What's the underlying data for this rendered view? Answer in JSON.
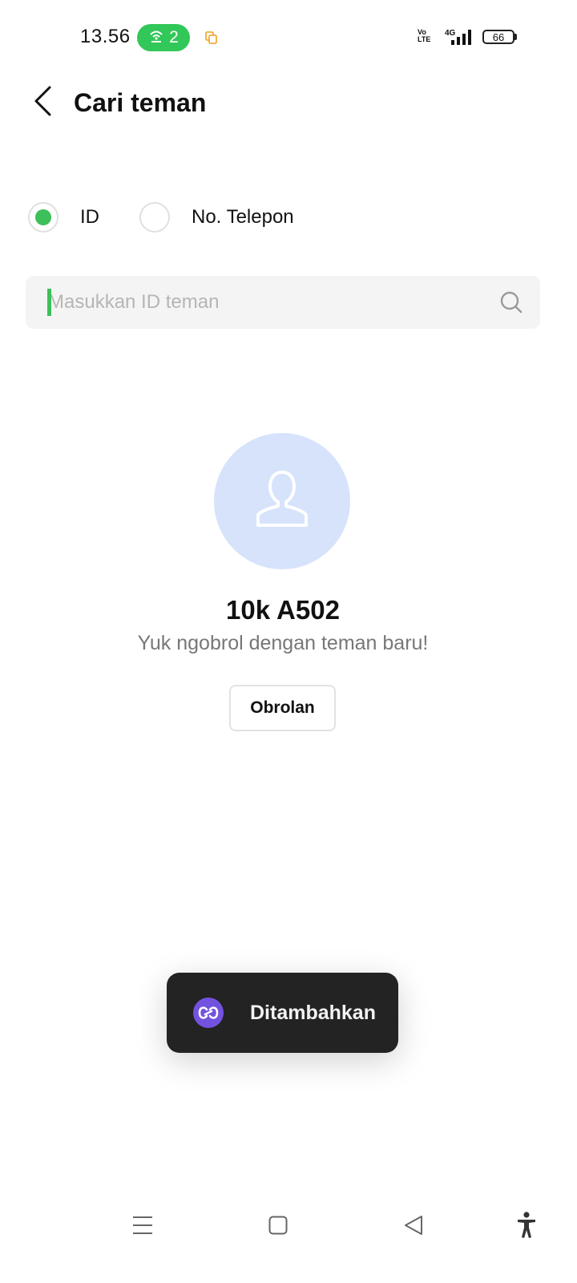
{
  "status_bar": {
    "time": "13.56",
    "hotspot_count": "2",
    "volte_top": "Vo",
    "volte_bottom": "LTE",
    "network": "4G",
    "battery": "66",
    "icons": [
      "hotspot-icon",
      "copy-icon",
      "volte-icon",
      "signal-icon",
      "battery-icon"
    ]
  },
  "header": {
    "title": "Cari teman",
    "back_icon": "chevron-left-icon"
  },
  "search_mode": {
    "options": [
      {
        "label": "ID",
        "selected": true
      },
      {
        "label": "No. Telepon",
        "selected": false
      }
    ]
  },
  "search": {
    "placeholder": "Masukkan ID teman",
    "value": "",
    "icon": "search-icon"
  },
  "profile": {
    "avatar_icon": "user-icon",
    "name": "10k A502",
    "subtitle": "Yuk ngobrol dengan teman baru!",
    "chat_button": "Obrolan"
  },
  "toast": {
    "icon": "link-icon",
    "text": "Ditambahkan"
  },
  "nav_bar": {
    "items": [
      "menu-icon",
      "home-icon",
      "back-icon",
      "accessibility-icon"
    ]
  },
  "colors": {
    "accent_green": "#3dbf5a",
    "hotspot_green": "#32c759",
    "avatar_bg": "#d6e3fb",
    "toast_bg": "#232323",
    "toast_icon_bg": "#7352e0"
  }
}
